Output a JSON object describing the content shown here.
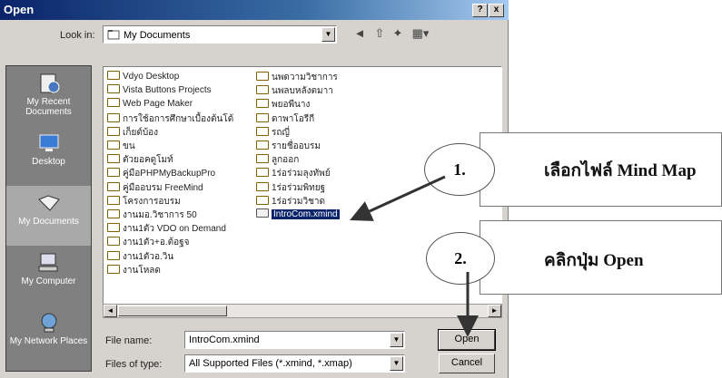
{
  "title": "Open",
  "title_buttons": {
    "help": "?",
    "close": "x"
  },
  "look_in": {
    "label": "Look in:",
    "value": "My Documents"
  },
  "toolbar": {
    "back": "◄",
    "up": "⇧",
    "new_folder": "✦",
    "views": "▦▾"
  },
  "places": [
    {
      "label": "My Recent Documents",
      "icon": "recent-docs-icon"
    },
    {
      "label": "Desktop",
      "icon": "desktop-icon"
    },
    {
      "label": "My Documents",
      "icon": "my-documents-icon"
    },
    {
      "label": "My Computer",
      "icon": "my-computer-icon"
    },
    {
      "label": "My Network Places",
      "icon": "network-places-icon"
    }
  ],
  "files_col1": [
    "Vdyo Desktop",
    "Vista Buttons Projects",
    "Web Page Maker",
    "การใช้อการศึกษาเบื้องต้นโด้",
    "เก็ยต์บ้อง",
    "ขน",
    "ตัวยอคดูโมท์",
    "คู่มือPHPMyBackupPro",
    "คู่มืออบรม FreeMind",
    "โครงการอบรม",
    "งานมอ.วิชาการ 50",
    "งาน1ตัว VDO on Demand",
    "งาน1ตัว+อ.ต้อฐจ",
    "งาน1ตัวอ.วิน",
    "งานโหลด"
  ],
  "files_col2": [
    "นพดวามวิชาการ",
    "นพลบหลังตมาา",
    "พยอพีนาง",
    "ดาพาโอรีกี",
    "รถญี่",
    "รายชื่ออบรม",
    "ลูกออก",
    "1ร่อร่วมลุงทัพย์",
    "1ร่อร่วมพิทยฐ",
    "1ร่อร่วมวิชาด",
    "IntroCom.xmind"
  ],
  "file_name": {
    "label": "File name:",
    "value": "IntroCom.xmind"
  },
  "files_of_type": {
    "label": "Files of type:",
    "value": "All Supported Files (*.xmind, *.xmap)"
  },
  "buttons": {
    "open": "Open",
    "cancel": "Cancel"
  },
  "callouts": [
    {
      "number": "1.",
      "text": "เลือกไฟล์ Mind Map"
    },
    {
      "number": "2.",
      "text": "คลิกปุ่ม Open"
    }
  ]
}
